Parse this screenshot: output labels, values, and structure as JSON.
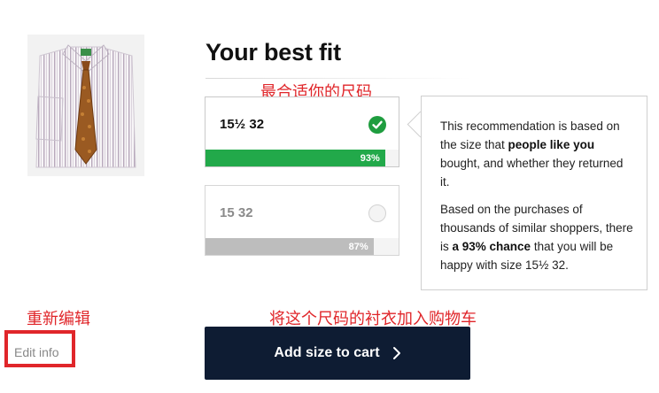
{
  "title": "Your best fit",
  "annotations": {
    "best_size": "最合适你的尺码",
    "edit": "重新编辑",
    "add_cart": "将这个尺码的衬衣加入购物车"
  },
  "sizes": [
    {
      "label": "15½ 32",
      "percent": 93,
      "percent_label": "93%",
      "selected": true
    },
    {
      "label": "15 32",
      "percent": 87,
      "percent_label": "87%",
      "selected": false
    }
  ],
  "info": {
    "p1_a": "This recommendation is based on the size that ",
    "p1_b": "people like you",
    "p1_c": " bought, and whether they returned it.",
    "p2_a": "Based on the purchases of thousands of similar shoppers, there is ",
    "p2_b": "a 93% chance",
    "p2_c": " that you will be happy with size 15½ 32."
  },
  "edit_info": "Edit info",
  "cart_button": "Add size to cart",
  "colors": {
    "selected_green": "#22a94a",
    "other_gray": "#bdbdbd",
    "button_navy": "#0e1c33",
    "annotation_red": "#e0262a"
  },
  "icons": [
    "shirt-image",
    "check-icon",
    "chevron-right-icon"
  ]
}
